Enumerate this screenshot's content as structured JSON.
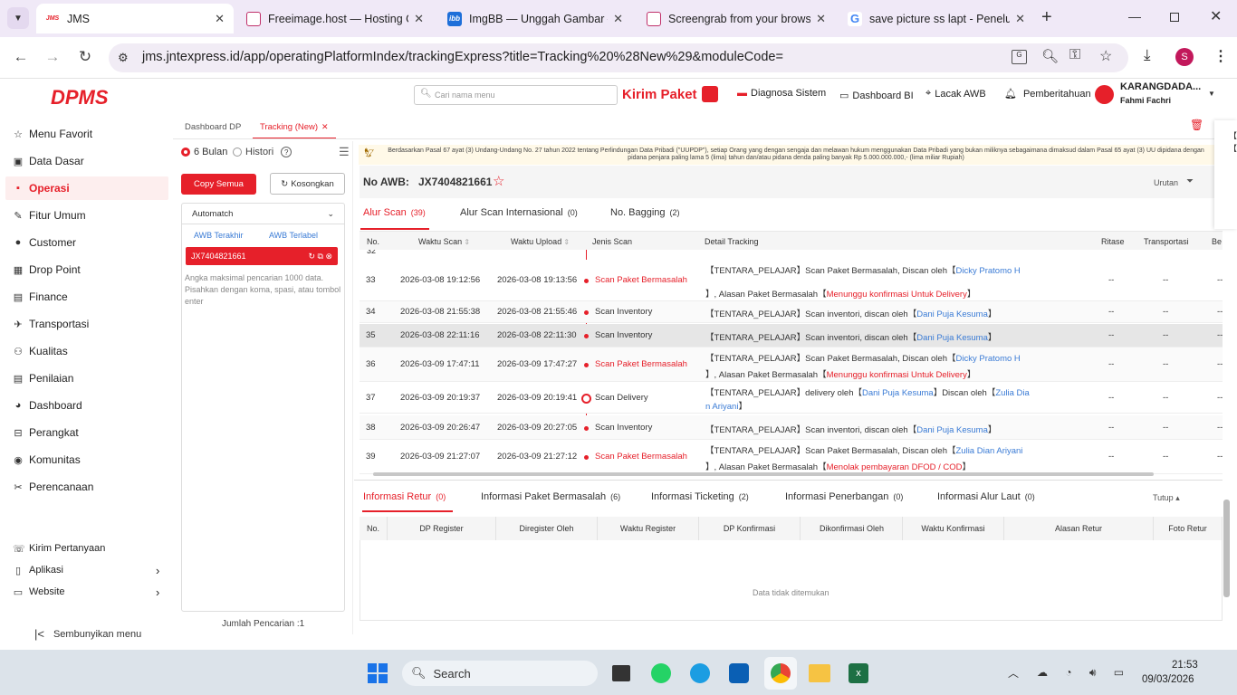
{
  "browser": {
    "tabs": [
      {
        "title": "JMS",
        "fav": "JMS"
      },
      {
        "title": "Freeimage.host — Hosting G",
        "fav": ""
      },
      {
        "title": "ImgBB — Unggah Gambar —",
        "fav": "ibb"
      },
      {
        "title": "Screengrab from your brows",
        "fav": ""
      },
      {
        "title": "save picture ss lapt - Penelu",
        "fav": "G"
      }
    ],
    "url": "jms.jntexpress.id/app/operatingPlatformIndex/trackingExpress?title=Tracking%20%28New%29&moduleCode=",
    "profile": "S"
  },
  "brand": {
    "logo": "DPMS",
    "accent": "#e6202a"
  },
  "sidebar": {
    "items": [
      {
        "label": "Menu Favorit",
        "icon": "star-icon"
      },
      {
        "label": "Data Dasar",
        "icon": "database-icon"
      },
      {
        "label": "Operasi",
        "icon": "operation-icon",
        "active": true
      },
      {
        "label": "Fitur Umum",
        "icon": "tool-icon"
      },
      {
        "label": "Customer",
        "icon": "user-icon"
      },
      {
        "label": "Drop Point",
        "icon": "drop-point-icon"
      },
      {
        "label": "Finance",
        "icon": "finance-icon"
      },
      {
        "label": "Transportasi",
        "icon": "plane-icon"
      },
      {
        "label": "Kualitas",
        "icon": "quality-icon"
      },
      {
        "label": "Penilaian",
        "icon": "rating-icon"
      },
      {
        "label": "Dashboard",
        "icon": "chart-icon"
      },
      {
        "label": "Perangkat",
        "icon": "device-icon"
      },
      {
        "label": "Komunitas",
        "icon": "community-icon"
      },
      {
        "label": "Perencanaan",
        "icon": "planning-icon"
      }
    ],
    "bottom": [
      {
        "label": "Kirim Pertanyaan",
        "icon": "ask-icon"
      },
      {
        "label": "Aplikasi",
        "icon": "app-icon"
      },
      {
        "label": "Website",
        "icon": "website-icon"
      }
    ],
    "hide_menu": "Sembunyikan menu"
  },
  "header": {
    "search_placeholder": "Cari nama menu",
    "kirim_paket": "Kirim Paket",
    "diagnosa": "Diagnosa Sistem",
    "dashboard_bi": "Dashboard BI",
    "lacak_awb": "Lacak AWB",
    "pemberitahuan": "Pemberitahuan",
    "user_name": "KARANGDADA...",
    "user_sub": "Fahmi Fachri"
  },
  "page_tabs": {
    "dashboard": "Dashboard DP",
    "tracking": "Tracking (New)"
  },
  "left_panel": {
    "radio_6": "6 Bulan",
    "radio_hist": "Histori",
    "copy_all": "Copy Semua",
    "clear": "Kosongkan",
    "mode": "Automatch",
    "tab_last": "AWB Terakhir",
    "tab_tagged": "AWB Terlabel",
    "awb": "JX7404821661",
    "hint": "Angka maksimal pencarian 1000 data. Pisahkan dengan koma, spasi, atau tombol enter",
    "count": "Jumlah Pencarian :1"
  },
  "banner": "Berdasarkan Pasal 67 ayat (3) Undang-Undang No. 27 tahun 2022 tentang Perlindungan Data Pribadi (\"UUPDP\"), setiap Orang yang dengan sengaja dan melawan hukum menggunakan Data Pribadi yang bukan miliknya sebagaimana dimaksud dalam Pasal 65 ayat (3) UU dipidana dengan pidana penjara paling lama 5 (lima) tahun dan/atau pidana denda paling banyak Rp 5.000.000.000,- (lima miliar Rupiah)",
  "awb_header": {
    "label": "No AWB:",
    "value": "JX7404821661",
    "sort": "Urutan"
  },
  "scan_tabs": [
    {
      "label": "Alur Scan",
      "count": "(39)"
    },
    {
      "label": "Alur Scan Internasional",
      "count": "(0)"
    },
    {
      "label": "No. Bagging",
      "count": "(2)"
    }
  ],
  "scan_cols": [
    "No.",
    "Waktu Scan",
    "Waktu Upload",
    "Jenis Scan",
    "Detail Tracking",
    "Ritase",
    "Transportasi",
    "Be"
  ],
  "rows": [
    {
      "no": "33",
      "scan": "2026-03-08 19:12:56",
      "upload": "2026-03-08 19:13:56",
      "type": "Scan Paket Bermasalah",
      "red": true,
      "d1": "【TENTARA_PELAJAR】Scan Paket Bermasalah, Discan oleh【",
      "n1": "Dicky Pratomo H",
      "d2": "】, Alasan Paket Bermasalah【",
      "r2": "Menunggu konfirmasi Untuk Delivery",
      "d3": "】"
    },
    {
      "no": "34",
      "scan": "2026-03-08 21:55:38",
      "upload": "2026-03-08 21:55:46",
      "type": "Scan Inventory",
      "red": false,
      "d1": "【TENTARA_PELAJAR】Scan inventori, discan oleh【",
      "n1": "Dani Puja Kesuma",
      "d2": "】"
    },
    {
      "no": "35",
      "scan": "2026-03-08 22:11:16",
      "upload": "2026-03-08 22:11:30",
      "type": "Scan Inventory",
      "red": false,
      "d1": "【TENTARA_PELAJAR】Scan inventori, discan oleh【",
      "n1": "Dani Puja Kesuma",
      "d2": "】"
    },
    {
      "no": "36",
      "scan": "2026-03-09 17:47:11",
      "upload": "2026-03-09 17:47:27",
      "type": "Scan Paket Bermasalah",
      "red": true,
      "d1": "【TENTARA_PELAJAR】Scan Paket Bermasalah, Discan oleh【",
      "n1": "Dicky Pratomo H",
      "d2": "】, Alasan Paket Bermasalah【",
      "r2": "Menunggu konfirmasi Untuk Delivery",
      "d3": "】"
    },
    {
      "no": "37",
      "scan": "2026-03-09 20:19:37",
      "upload": "2026-03-09 20:19:41",
      "type": "Scan Delivery",
      "red": false,
      "d1": "【TENTARA_PELAJAR】delivery oleh【",
      "n1": "Dani Puja Kesuma",
      "d1b": "】Discan oleh【",
      "n1b": "Zulia Dia",
      "n2": "n Ariyani",
      "d2": "】"
    },
    {
      "no": "38",
      "scan": "2026-03-09 20:26:47",
      "upload": "2026-03-09 20:27:05",
      "type": "Scan Inventory",
      "red": false,
      "d1": "【TENTARA_PELAJAR】Scan inventori, discan oleh【",
      "n1": "Dani Puja Kesuma",
      "d2": "】"
    },
    {
      "no": "39",
      "scan": "2026-03-09 21:27:07",
      "upload": "2026-03-09 21:27:12",
      "type": "Scan Paket Bermasalah",
      "red": true,
      "d1": "【TENTARA_PELAJAR】Scan Paket Bermasalah, Discan oleh【",
      "n1": "Zulia Dian Ariyani",
      "d2": "】, Alasan Paket Bermasalah【",
      "r2": "Menolak pembayaran DFOD / COD",
      "d3": "】"
    }
  ],
  "row_dash": "--",
  "info_tabs": [
    {
      "label": "Informasi Retur",
      "count": "(0)"
    },
    {
      "label": "Informasi Paket Bermasalah",
      "count": "(6)"
    },
    {
      "label": "Informasi Ticketing",
      "count": "(2)"
    },
    {
      "label": "Informasi Penerbangan",
      "count": "(0)"
    },
    {
      "label": "Informasi Alur Laut",
      "count": "(0)"
    }
  ],
  "collapse": "Tutup",
  "info_cols": [
    "No.",
    "DP Register",
    "Diregister Oleh",
    "Waktu Register",
    "DP Konfirmasi",
    "Dikonfirmasi Oleh",
    "Waktu Konfirmasi",
    "Alasan Retur",
    "Foto Retur"
  ],
  "empty": "Data tidak ditemukan",
  "taskbar": {
    "search": "Search",
    "time": "21:53",
    "date": "09/03/2026"
  }
}
